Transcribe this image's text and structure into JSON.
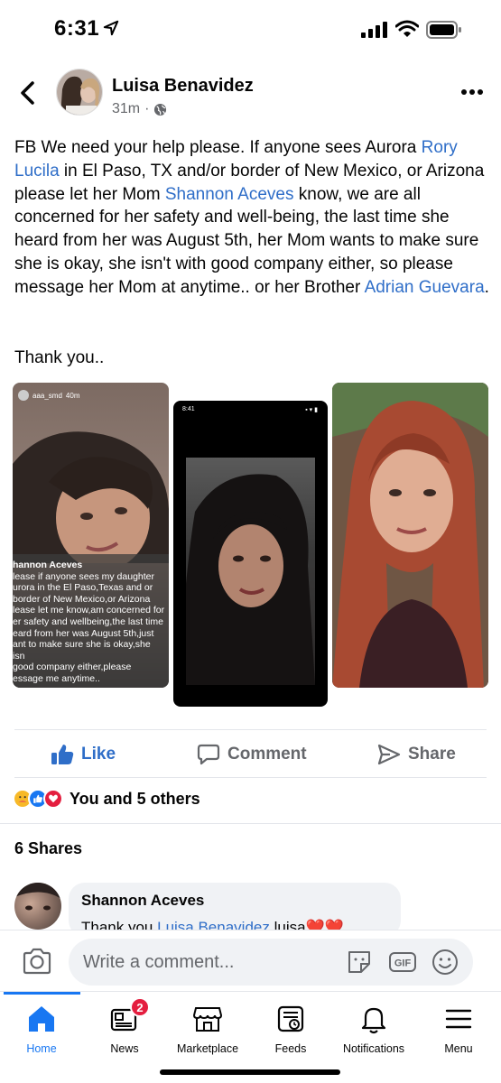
{
  "status_bar": {
    "time": "6:31"
  },
  "post": {
    "author": "Luisa Benavidez",
    "time_ago": "31m",
    "text_segments": [
      {
        "text": "FB We need your help please. If anyone sees Aurora ",
        "link": false
      },
      {
        "text": "Rory Lucila",
        "link": true
      },
      {
        "text": " in El Paso, TX and/or border of New Mexico, or Arizona please let her Mom ",
        "link": false
      },
      {
        "text": "Shannon Aceves",
        "link": true
      },
      {
        "text": " know, we are all concerned for her safety and well-being, the last time she heard from her was August 5th, her Mom wants to make sure she is okay, she isn't with good company either, so please message her Mom at anytime.. or her Brother ",
        "link": false
      },
      {
        "text": "Adrian Guevara",
        "link": true
      },
      {
        "text": ".",
        "link": false
      }
    ],
    "thanks": "Thank you..",
    "photos": {
      "photo1": {
        "username": "aaa_smd",
        "age": "40m",
        "caption_title": "hannon Aceves",
        "caption_lines": [
          "lease if anyone sees my daughter",
          "urora in the El Paso,Texas and or",
          "border of New Mexico,or Arizona",
          "lease let me know,am concerned for",
          "er safety and wellbeing,the last time",
          "eard from her was August 5th,just",
          "ant to make sure she is okay,she isn",
          "good company either,please",
          "essage me anytime.."
        ]
      },
      "photo2": {
        "status_time": "8:41"
      }
    }
  },
  "actions": {
    "like": "Like",
    "comment": "Comment",
    "share": "Share"
  },
  "reactions": {
    "summary": "You and 5 others"
  },
  "shares": "6 Shares",
  "comment": {
    "author": "Shannon Aceves",
    "text_prefix": "Thank you ",
    "mention": "Luisa Benavidez",
    "text_suffix": " luisa❤️❤️"
  },
  "composer": {
    "placeholder": "Write a comment..."
  },
  "tabs": [
    {
      "label": "Home"
    },
    {
      "label": "News",
      "badge": "2"
    },
    {
      "label": "Marketplace"
    },
    {
      "label": "Feeds"
    },
    {
      "label": "Notifications"
    },
    {
      "label": "Menu"
    }
  ],
  "colors": {
    "link": "#2f6ec8",
    "brand": "#1877f2",
    "badge": "#e41e3f"
  }
}
